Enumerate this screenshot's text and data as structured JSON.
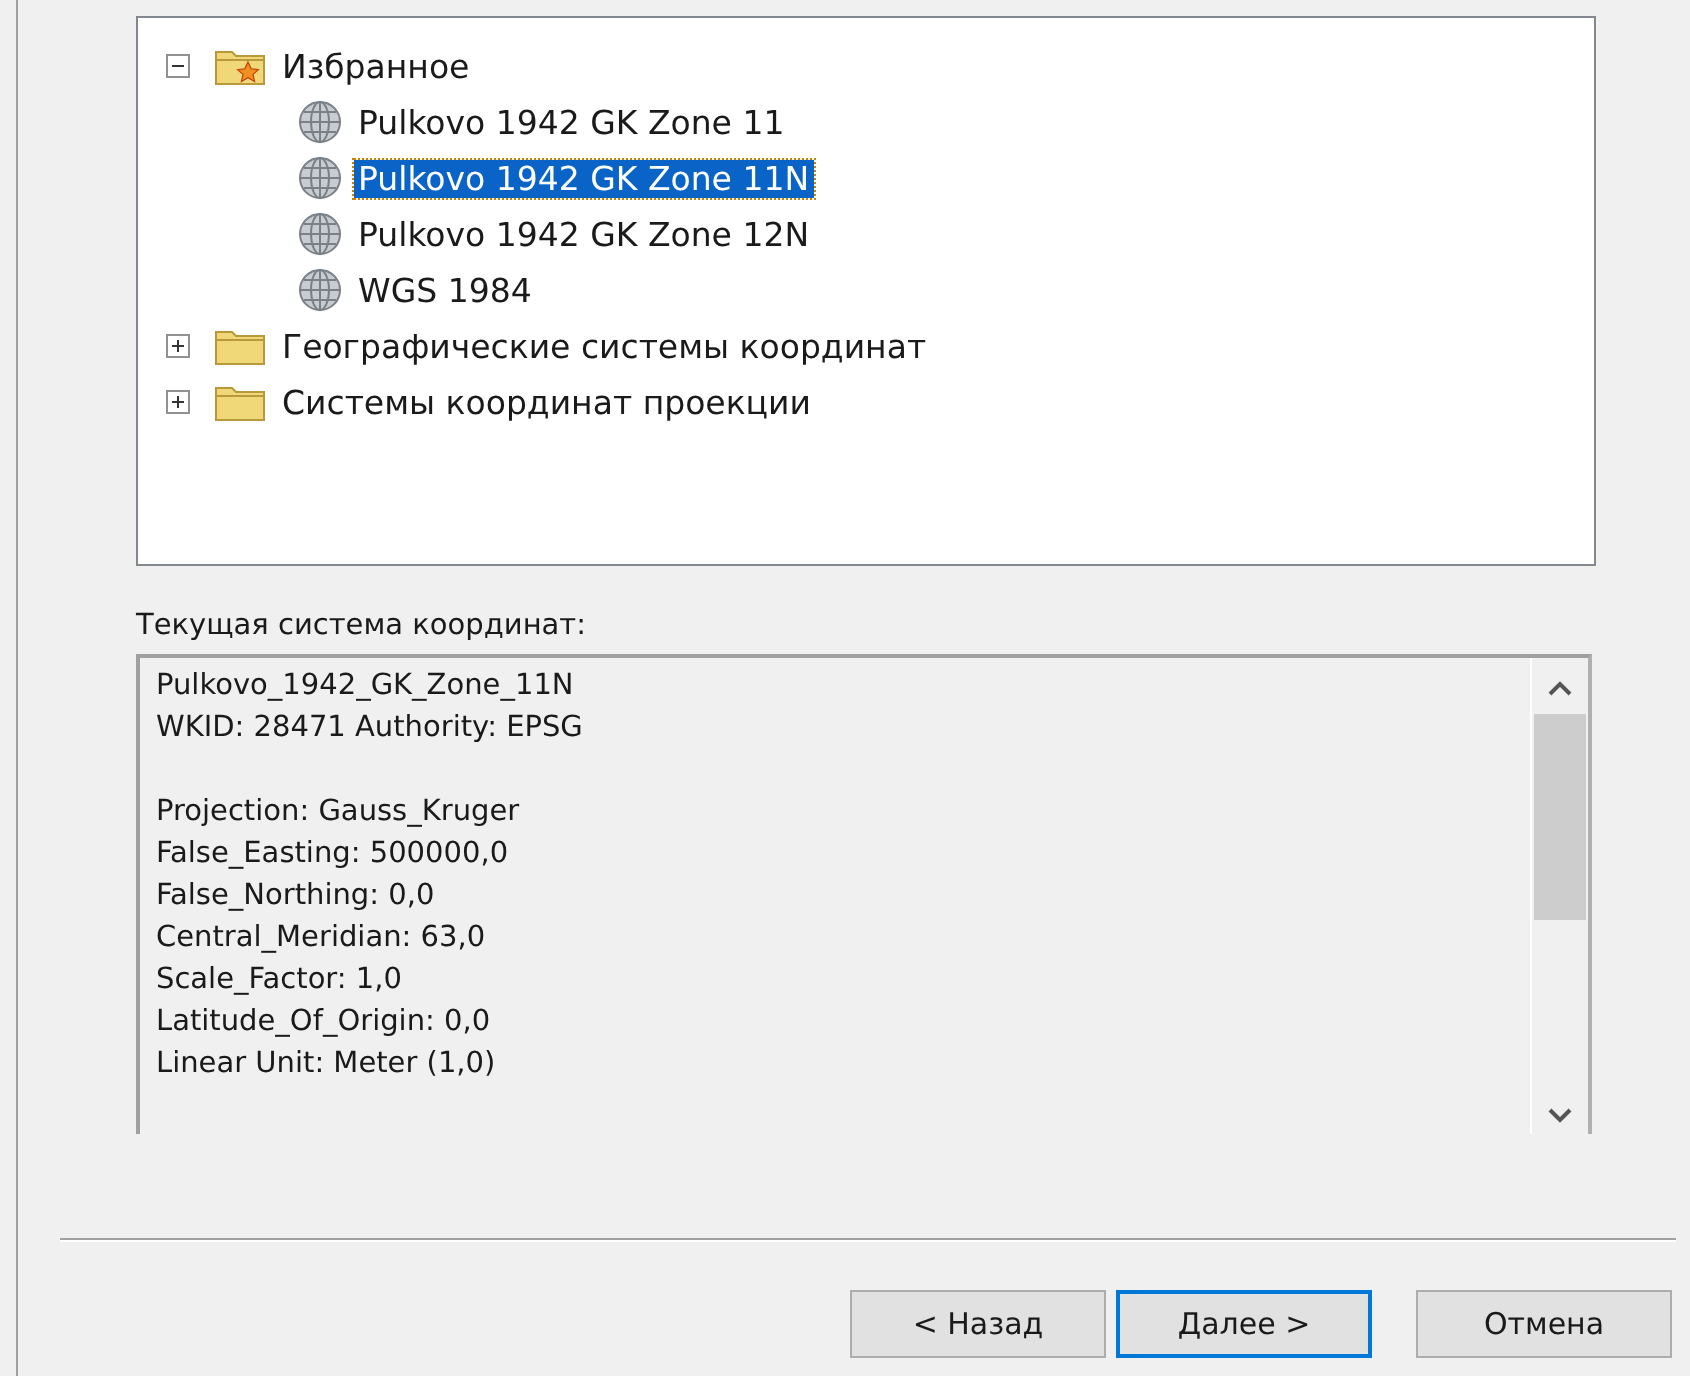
{
  "tree": {
    "items": [
      {
        "label": "Избранное",
        "kind": "favorites",
        "expanded": true,
        "selected": false,
        "children": [
          {
            "label": "Pulkovo 1942 GK Zone 11",
            "kind": "crs",
            "selected": false
          },
          {
            "label": "Pulkovo 1942 GK Zone 11N",
            "kind": "crs",
            "selected": true
          },
          {
            "label": "Pulkovo 1942 GK Zone 12N",
            "kind": "crs",
            "selected": false
          },
          {
            "label": "WGS 1984",
            "kind": "crs",
            "selected": false
          }
        ]
      },
      {
        "label": "Географические системы координат",
        "kind": "folder",
        "expanded": false,
        "selected": false
      },
      {
        "label": "Системы координат проекции",
        "kind": "folder",
        "expanded": false,
        "selected": false
      }
    ]
  },
  "details": {
    "label": "Текущая система координат:",
    "paragraphs": [
      [
        "Pulkovo_1942_GK_Zone_11N",
        "WKID: 28471 Authority: EPSG"
      ],
      [
        "Projection: Gauss_Kruger",
        "False_Easting: 500000,0",
        "False_Northing: 0,0",
        "Central_Meridian: 63,0",
        "Scale_Factor: 1,0",
        "Latitude_Of_Origin: 0,0",
        "Linear Unit: Meter (1,0)"
      ]
    ]
  },
  "buttons": [
    {
      "label": "< Назад",
      "default": false
    },
    {
      "label": "Далее >",
      "default": true
    },
    {
      "label": "Отмена",
      "default": false
    }
  ]
}
